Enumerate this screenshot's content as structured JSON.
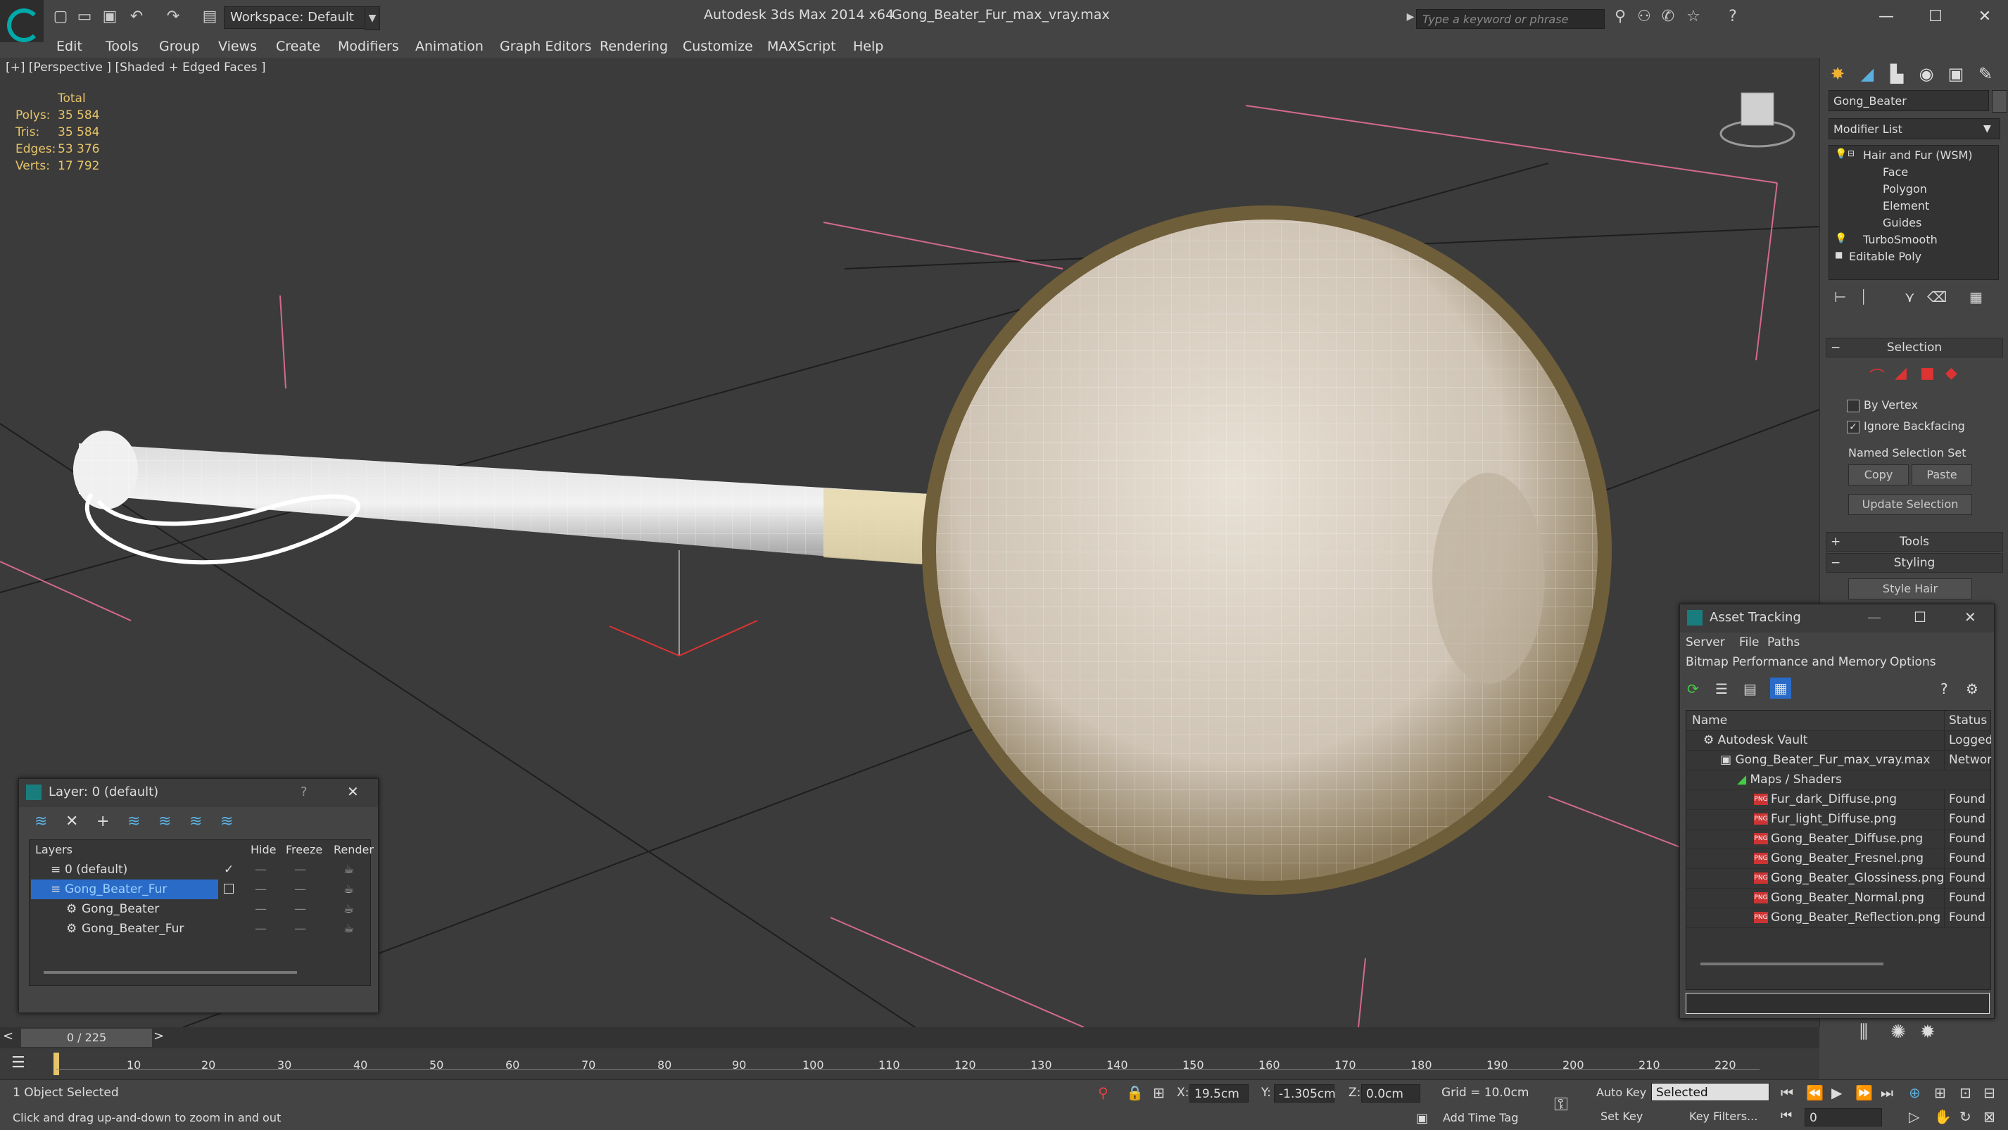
{
  "titlebar": {
    "workspace": "Workspace: Default",
    "app_title": "Autodesk 3ds Max  2014 x64",
    "file_title": "Gong_Beater_Fur_max_vray.max",
    "search_placeholder": "Type a keyword or phrase"
  },
  "menu": [
    "Edit",
    "Tools",
    "Group",
    "Views",
    "Create",
    "Modifiers",
    "Animation",
    "Graph Editors",
    "Rendering",
    "Customize",
    "MAXScript",
    "Help"
  ],
  "viewport": {
    "label": "[+] [Perspective ] [Shaded + Edged Faces ]",
    "stats": {
      "total_label": "Total",
      "rows": [
        {
          "label": "Polys:",
          "value": "35 584"
        },
        {
          "label": "Tris:",
          "value": "35 584"
        },
        {
          "label": "Edges:",
          "value": "53 376"
        },
        {
          "label": "Verts:",
          "value": "17 792"
        }
      ]
    }
  },
  "command_panel": {
    "object_name": "Gong_Beater",
    "modifier_list": "Modifier List",
    "stack": [
      {
        "label": "Hair and Fur (WSM)",
        "level": 0
      },
      {
        "label": "Face",
        "level": 1
      },
      {
        "label": "Polygon",
        "level": 1
      },
      {
        "label": "Element",
        "level": 1
      },
      {
        "label": "Guides",
        "level": 1
      },
      {
        "label": "TurboSmooth",
        "level": 0
      },
      {
        "label": "Editable Poly",
        "level": 0
      }
    ],
    "selection_title": "Selection",
    "by_vertex": "By Vertex",
    "ignore_backfacing": "Ignore Backfacing",
    "named_selection_set": "Named Selection Set",
    "copy": "Copy",
    "paste": "Paste",
    "update_selection": "Update Selection",
    "tools_title": "Tools",
    "styling_title": "Styling",
    "style_hair": "Style Hair"
  },
  "layer_window": {
    "title": "Layer: 0 (default)",
    "help": "?",
    "columns": [
      "Layers",
      "Hide",
      "Freeze",
      "Render"
    ],
    "rows": [
      {
        "name": "0 (default)",
        "indent": 0,
        "selected": false
      },
      {
        "name": "Gong_Beater_Fur",
        "indent": 0,
        "selected": true
      },
      {
        "name": "Gong_Beater",
        "indent": 1,
        "selected": false
      },
      {
        "name": "Gong_Beater_Fur",
        "indent": 1,
        "selected": false
      }
    ]
  },
  "asset_window": {
    "title": "Asset Tracking",
    "menu": [
      "Server",
      "File",
      "Paths"
    ],
    "menu2": [
      "Bitmap Performance and Memory",
      "Options"
    ],
    "columns": [
      "Name",
      "Status"
    ],
    "rows": [
      {
        "name": "Autodesk Vault",
        "status": "Logged",
        "indent": 0,
        "png": false
      },
      {
        "name": "Gong_Beater_Fur_max_vray.max",
        "status": "Network",
        "indent": 1,
        "png": false
      },
      {
        "name": "Maps / Shaders",
        "status": "",
        "indent": 2,
        "png": false
      },
      {
        "name": "Fur_dark_Diffuse.png",
        "status": "Found",
        "indent": 3,
        "png": true
      },
      {
        "name": "Fur_light_Diffuse.png",
        "status": "Found",
        "indent": 3,
        "png": true
      },
      {
        "name": "Gong_Beater_Diffuse.png",
        "status": "Found",
        "indent": 3,
        "png": true
      },
      {
        "name": "Gong_Beater_Fresnel.png",
        "status": "Found",
        "indent": 3,
        "png": true
      },
      {
        "name": "Gong_Beater_Glossiness.png",
        "status": "Found",
        "indent": 3,
        "png": true
      },
      {
        "name": "Gong_Beater_Normal.png",
        "status": "Found",
        "indent": 3,
        "png": true
      },
      {
        "name": "Gong_Beater_Reflection.png",
        "status": "Found",
        "indent": 3,
        "png": true
      }
    ]
  },
  "timeline": {
    "frame": "0 / 225",
    "ticks": [
      "10",
      "20",
      "30",
      "40",
      "50",
      "60",
      "70",
      "80",
      "90",
      "100",
      "110",
      "120",
      "130",
      "140",
      "150",
      "160",
      "170",
      "180",
      "190",
      "200",
      "210",
      "220"
    ]
  },
  "status": {
    "selected": "1 Object Selected",
    "prompt": "Click and drag up-and-down to zoom in and out",
    "x_label": "X:",
    "x_value": "19.5cm",
    "y_label": "Y:",
    "y_value": "-1.305cm",
    "z_label": "Z:",
    "z_value": "0.0cm",
    "grid": "Grid = 10.0cm",
    "auto_key": "Auto Key",
    "selected_dropdown": "Selected",
    "set_key": "Set Key",
    "key_filters": "Key Filters...",
    "add_time_tag": "Add Time Tag",
    "frame_field": "0"
  }
}
